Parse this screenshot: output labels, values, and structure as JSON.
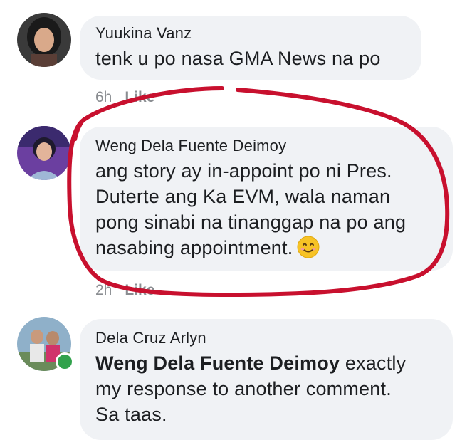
{
  "comments": [
    {
      "author": "Yuukina Vanz",
      "text": "tenk u po nasa GMA News na po",
      "time": "6h",
      "like_label": "Like"
    },
    {
      "author": "Weng Dela Fuente Deimoy",
      "lines": [
        "ang story ay in-appoint po ni Pres.",
        "Duterte ang Ka EVM, wala naman",
        "pong sinabi na tinanggap na po ang",
        "nasabing appointment."
      ],
      "emoji": "smiling-face-emoji",
      "time": "2h",
      "like_label": "Like"
    },
    {
      "author": "Dela Cruz Arlyn",
      "mention": "Weng Dela Fuente Deimoy",
      "line1_rest": " exactly",
      "line2": "my response to another comment.",
      "line3": "Sa taas.",
      "online": true
    }
  ],
  "colors": {
    "bubble": "#f0f2f5",
    "annotation_red": "#c8102e",
    "online_green": "#31a24c",
    "meta_gray": "#8a8d91"
  }
}
